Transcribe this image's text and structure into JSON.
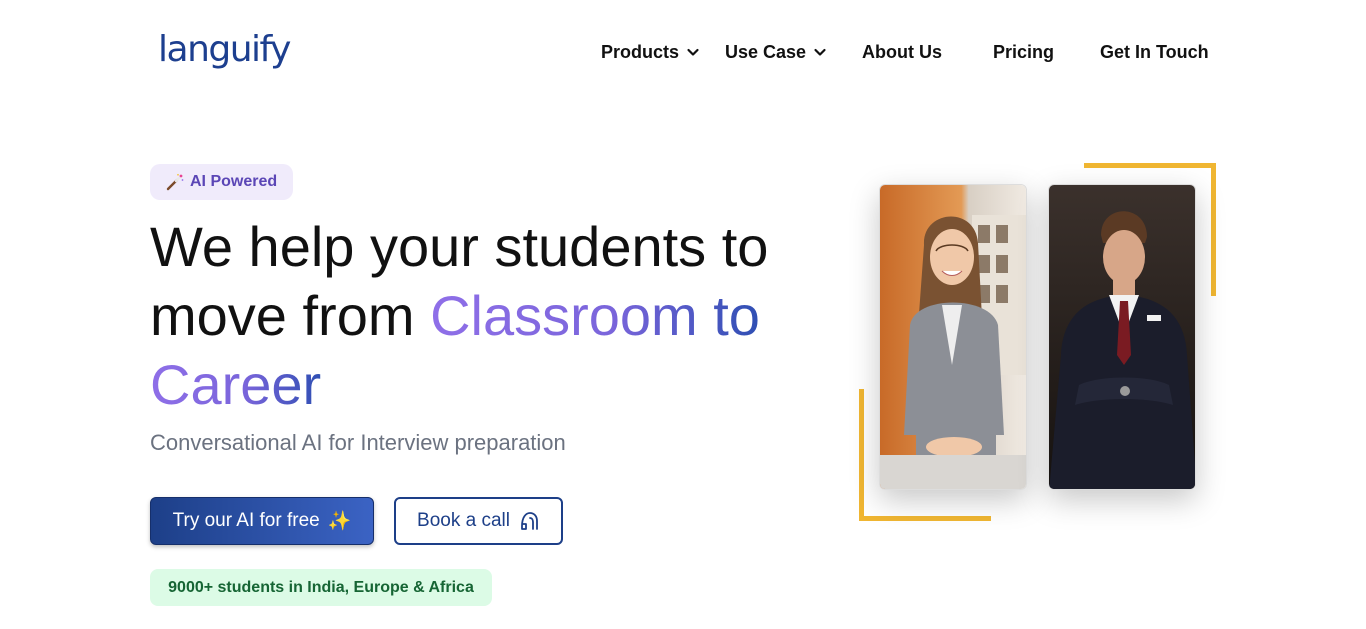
{
  "header": {
    "logo": "languify",
    "nav": [
      {
        "label": "Products",
        "has_dropdown": true
      },
      {
        "label": "Use Case",
        "has_dropdown": true
      },
      {
        "label": "About Us",
        "has_dropdown": false
      },
      {
        "label": "Pricing",
        "has_dropdown": false
      },
      {
        "label": "Get In Touch",
        "has_dropdown": false
      }
    ]
  },
  "hero": {
    "badge": {
      "icon": "magic-wand-icon",
      "label": "AI Powered"
    },
    "headline": {
      "line1": "We help your students to",
      "line2_plain": "move from ",
      "line2_highlight": "Classroom to",
      "line3_highlight": "Career"
    },
    "subtitle": "Conversational AI for Interview preparation",
    "cta_primary": {
      "label": "Try our AI for free",
      "icon": "sparkles-icon"
    },
    "cta_secondary": {
      "label": "Book a call",
      "icon": "headset-icon"
    },
    "stat": "9000+ students in India, Europe & Africa",
    "images": [
      {
        "name": "woman-portrait"
      },
      {
        "name": "man-portrait"
      }
    ]
  },
  "colors": {
    "brand_blue": "#1d3f88",
    "accent_purple": "#8f6fe8",
    "frame_yellow": "#f0b632",
    "badge_bg": "#f0ebfb",
    "stat_bg": "#dcfbe6",
    "stat_text": "#166534"
  }
}
